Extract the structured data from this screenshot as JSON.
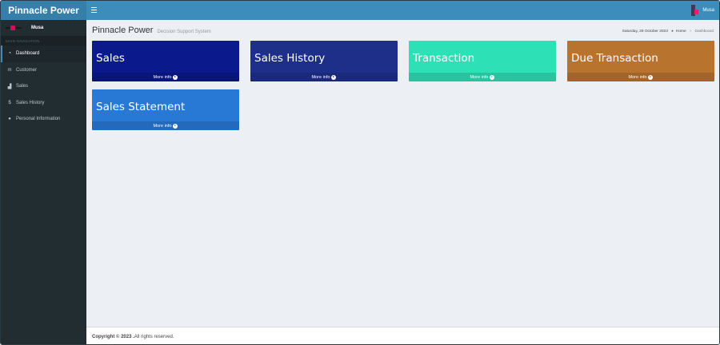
{
  "app": {
    "logo": "Pinnacle Power"
  },
  "sidebar": {
    "user_name": "Musa",
    "nav_header": "MAIN NAVIGATION",
    "items": [
      {
        "label": "Dashboard",
        "icon": "dashboard-icon",
        "active": true
      },
      {
        "label": "Customer",
        "icon": "users-icon",
        "active": false
      },
      {
        "label": "Sales",
        "icon": "chart-icon",
        "active": false
      },
      {
        "label": "Sales History",
        "icon": "dollar-icon",
        "active": false
      },
      {
        "label": "Personal Information",
        "icon": "user-icon",
        "active": false
      }
    ]
  },
  "header": {
    "user_name": "Musa"
  },
  "content": {
    "title": "Pinnacle Power",
    "subtitle": "Decision Support System",
    "date": "Saturday, 28 October 2023",
    "breadcrumb": {
      "home": "Home",
      "current": "Dashboard"
    }
  },
  "tiles": [
    {
      "title": "Sales",
      "footer": "More info",
      "color": "#0a1a8c"
    },
    {
      "title": "Sales History",
      "footer": "More info",
      "color": "#1e2f8a"
    },
    {
      "title": "Transaction",
      "footer": "More info",
      "color": "#2ee0b6"
    },
    {
      "title": "Due Transaction",
      "footer": "More info",
      "color": "#b8742f"
    },
    {
      "title": "Sales Statement",
      "footer": "More info",
      "color": "#2878d6"
    }
  ],
  "footer": {
    "copyright": "Copyright © 2023 .",
    "rights": " All rights reserved."
  },
  "colors": {
    "header": "#3c8dbc",
    "logo_bg": "#367fa9",
    "sidebar": "#222d32",
    "content_bg": "#ecf0f5"
  }
}
